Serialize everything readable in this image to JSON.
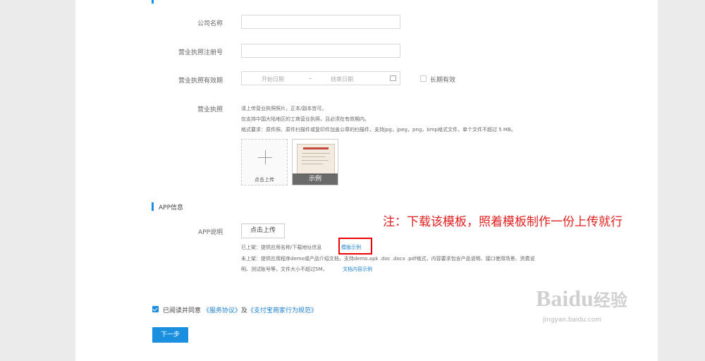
{
  "form": {
    "company_name_label": "公司名称",
    "license_no_label": "营业执照注册号",
    "license_period_label": "营业执照有效期",
    "start_date_placeholder": "开始日期",
    "range_sep": "~",
    "end_date_placeholder": "结束日期",
    "long_term_label": "长期有效",
    "license_label": "营业执照",
    "license_hint_1": "请上传营业执照照片，正本/副本皆可。",
    "license_hint_2": "仅支持中国大陆地区的工商营业执照，且必须在有效期内。",
    "license_hint_3": "格式要求：原件照、原件扫描件或复印件加盖公章的扫描件，支持jpg，jpeg，png，bmp格式文件，单个文件不超过 5 MB。",
    "upload_label": "点击上传",
    "sample_label": "示例"
  },
  "app_section": {
    "title": "APP信息",
    "desc_label": "APP说明",
    "upload_button": "点击上传",
    "online_text": "已上架：提供应用名称/下载地址信息",
    "template_link": "模版示例",
    "offline_text": "未上架：提供应用程序demo或产品介绍文档，支持demo.apk .doc .docx .pdf格式，内容要求包含产品说明、接口使用场景、资费说",
    "offline_text_2": "明、测试账号等，文件大小不超过5M，",
    "doc_link": "文档内容示例"
  },
  "annotation": "注：下载该模板，照着模板制作一份上传就行",
  "agreement": {
    "prefix": "已阅读并同意",
    "service_link": "《服务协议》",
    "and": "及",
    "rules_link": "《支付宝商家行为规范》"
  },
  "next_button": "下一步",
  "watermark": {
    "brand": "Bai",
    "brand2": "du",
    "cn": "经验",
    "url": "jingyan.baidu.com"
  },
  "colors": {
    "accent": "#1a8fe0",
    "annotation": "#e02020"
  }
}
